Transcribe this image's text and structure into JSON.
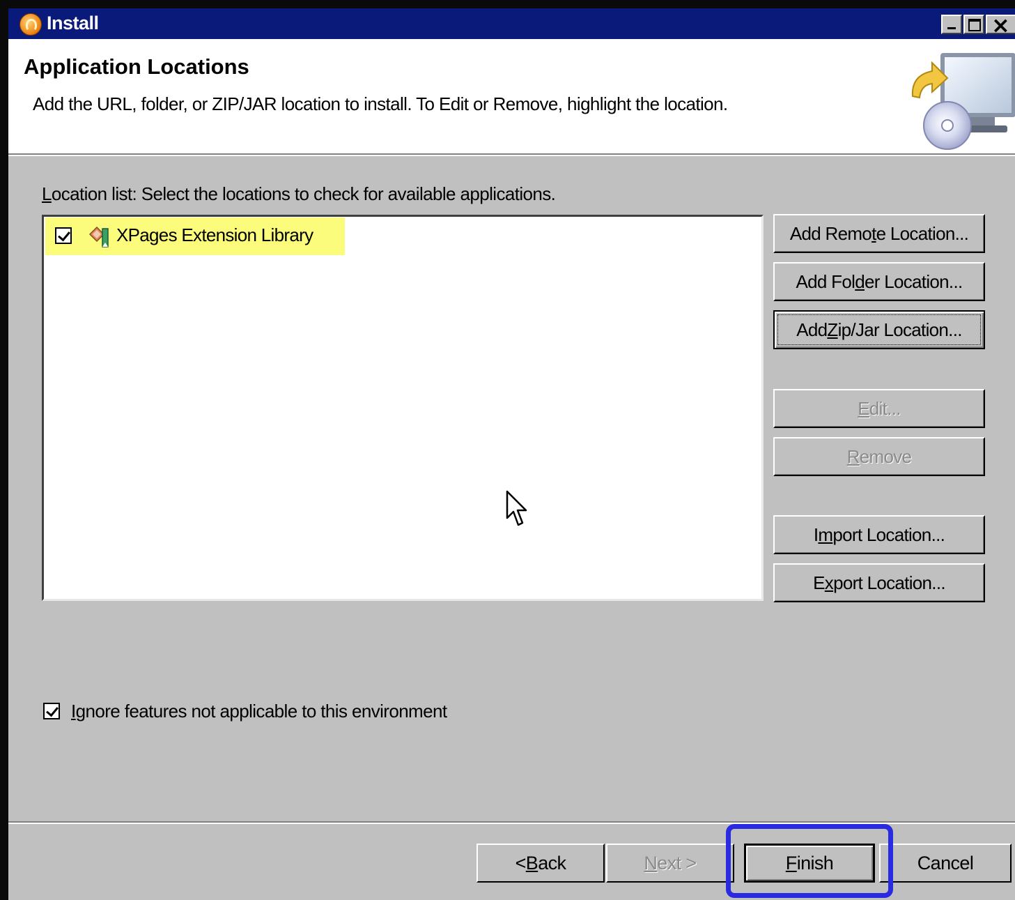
{
  "window": {
    "title": "Install"
  },
  "header": {
    "title": "Application Locations",
    "description": "Add the URL, folder, or ZIP/JAR location to install. To Edit or Remove, highlight the location."
  },
  "location_list": {
    "label_mnemonic": "L",
    "label_rest": "ocation list: Select the locations to check for available applications.",
    "items": [
      {
        "label": "XPages Extension Library",
        "checked": true,
        "icon": "site-location-icon",
        "highlight_color": "#fbfb7c"
      }
    ]
  },
  "side_buttons": {
    "add_remote": {
      "pre": "Add Remo",
      "mn": "t",
      "post": "e Location..."
    },
    "add_folder": {
      "pre": "Add Fol",
      "mn": "d",
      "post": "er Location..."
    },
    "add_zip": {
      "pre": "Add ",
      "mn": "Z",
      "post": "ip/Jar Location..."
    },
    "edit": {
      "pre": "",
      "mn": "E",
      "post": "dit...",
      "disabled": true
    },
    "remove": {
      "pre": "",
      "mn": "R",
      "post": "emove",
      "disabled": true
    },
    "import": {
      "pre": "I",
      "mn": "m",
      "post": "port Location..."
    },
    "export": {
      "pre": "E",
      "mn": "x",
      "post": "port Location..."
    }
  },
  "options": {
    "ignore_mn": "I",
    "ignore_rest": "gnore features not applicable to this environment",
    "ignore_checked": true
  },
  "footer": {
    "back": {
      "pre": "< ",
      "mn": "B",
      "post": "ack"
    },
    "next": {
      "pre": "",
      "mn": "N",
      "post": "ext >",
      "disabled": true
    },
    "finish": {
      "pre": "",
      "mn": "F",
      "post": "inish"
    },
    "cancel": {
      "label": "Cancel"
    }
  },
  "colors": {
    "titlebar": "#0a1a7a",
    "highlight_annotation": "#2a2ae0",
    "dialog_bg": "#c0c0c0"
  }
}
